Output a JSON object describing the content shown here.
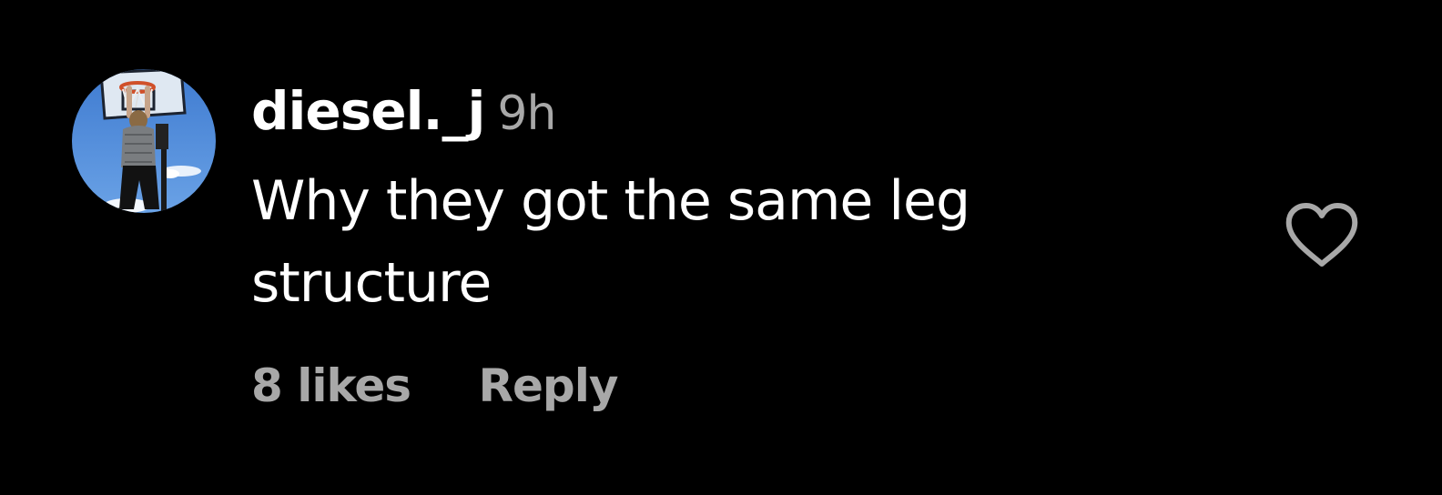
{
  "comment": {
    "avatar_icon": "profile-photo-basketball-dunk",
    "username": "diesel._j",
    "timestamp": "9h",
    "text": "Why they got the same leg structure",
    "likes_label": "8 likes",
    "reply_label": "Reply",
    "like_icon": "heart-outline-icon"
  },
  "colors": {
    "background": "#000000",
    "primary_text": "#ffffff",
    "secondary_text": "#a8a8a8",
    "heart": "#a8a8a8"
  }
}
